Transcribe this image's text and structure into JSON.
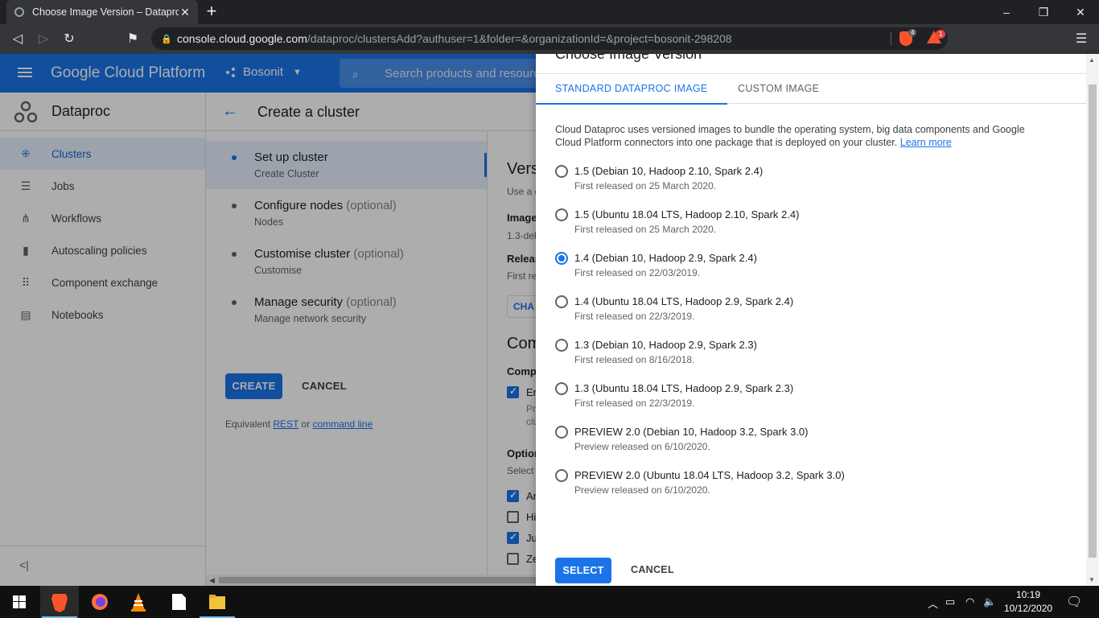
{
  "browser": {
    "tab_title": "Choose Image Version – Dataproc",
    "new_tab": "+",
    "url_host": "console.cloud.google.com",
    "url_rest": "/dataproc/clustersAdd?authuser=1&folder=&organizationId=&project=bosonit-298208",
    "shield_count": "4",
    "rewards_count": "1",
    "window_controls": {
      "minimize": "–",
      "restore": "❐",
      "close": "✕"
    },
    "nav": {
      "back": "◁",
      "forward": "▷",
      "reload": "↻",
      "bookmark": "⚑",
      "menu": "☰"
    }
  },
  "header": {
    "product_name": "Google Cloud Platform",
    "project": "Bosonit",
    "search_placeholder": "Search products and resources"
  },
  "sidebar": {
    "title": "Dataproc",
    "items": [
      {
        "label": "Clusters",
        "icon": "clusters-icon",
        "glyph": "⁜"
      },
      {
        "label": "Jobs",
        "icon": "list-icon",
        "glyph": "☰"
      },
      {
        "label": "Workflows",
        "icon": "workflow-icon",
        "glyph": "⋔"
      },
      {
        "label": "Autoscaling policies",
        "icon": "bar-chart-icon",
        "glyph": "▮"
      },
      {
        "label": "Component exchange",
        "icon": "grid-icon",
        "glyph": "⠿"
      },
      {
        "label": "Notebooks",
        "icon": "notebook-icon",
        "glyph": "▤"
      }
    ],
    "collapse": "<|"
  },
  "main": {
    "back": "←",
    "title": "Create a cluster",
    "steps": [
      {
        "title": "Set up cluster",
        "optional": "",
        "sub": "Create Cluster"
      },
      {
        "title": "Configure nodes",
        "optional": "(optional)",
        "sub": "Nodes"
      },
      {
        "title": "Customise cluster",
        "optional": "(optional)",
        "sub": "Customise"
      },
      {
        "title": "Manage security",
        "optional": "(optional)",
        "sub": "Manage network security"
      }
    ],
    "create": "CREATE",
    "cancel": "CANCEL",
    "equiv_prefix": "Equivalent",
    "equiv_rest": "REST",
    "equiv_or": "or",
    "equiv_cmd": "command line",
    "peek": {
      "vers": "Vers",
      "use": "Use a c",
      "image": "Image",
      "image_val": "1.3-deb",
      "release": "Releas",
      "first": "First re",
      "change": "CHA",
      "com": "Com",
      "compo": "Compo",
      "en": "En",
      "pr": "Pr",
      "cl": "clu",
      "option": "Option",
      "select": "Select",
      "an": "An",
      "hi": "Hi",
      "ju": "Ju",
      "ze": "Ze"
    }
  },
  "dialog": {
    "title": "Choose Image Version",
    "tabs": [
      "STANDARD DATAPROC IMAGE",
      "CUSTOM IMAGE"
    ],
    "description": "Cloud Dataproc uses versioned images to bundle the operating system, big data components and Google Cloud Platform connectors into one package that is deployed on your cluster.",
    "learn_more": "Learn more",
    "selected_index": 2,
    "options": [
      {
        "label": "1.5 (Debian 10, Hadoop 2.10, Spark 2.4)",
        "sub": "First released on 25 March 2020."
      },
      {
        "label": "1.5 (Ubuntu 18.04 LTS, Hadoop 2.10, Spark 2.4)",
        "sub": "First released on 25 March 2020."
      },
      {
        "label": "1.4 (Debian 10, Hadoop 2.9, Spark 2.4)",
        "sub": "First released on 22/03/2019."
      },
      {
        "label": "1.4 (Ubuntu 18.04 LTS, Hadoop 2.9, Spark 2.4)",
        "sub": "First released on 22/3/2019."
      },
      {
        "label": "1.3 (Debian 10, Hadoop 2.9, Spark 2.3)",
        "sub": "First released on 8/16/2018."
      },
      {
        "label": "1.3 (Ubuntu 18.04 LTS, Hadoop 2.9, Spark 2.3)",
        "sub": "First released on 22/3/2019."
      },
      {
        "label": "PREVIEW 2.0 (Debian 10, Hadoop 3.2, Spark 3.0)",
        "sub": "Preview released on 6/10/2020."
      },
      {
        "label": "PREVIEW 2.0 (Ubuntu 18.04 LTS, Hadoop 3.2, Spark 3.0)",
        "sub": "Preview released on 6/10/2020."
      }
    ],
    "select": "SELECT",
    "cancel": "CANCEL"
  },
  "taskbar": {
    "time": "10:19",
    "date": "10/12/2020"
  },
  "colors": {
    "accent": "#1a73e8",
    "brave": "#fb542b"
  }
}
